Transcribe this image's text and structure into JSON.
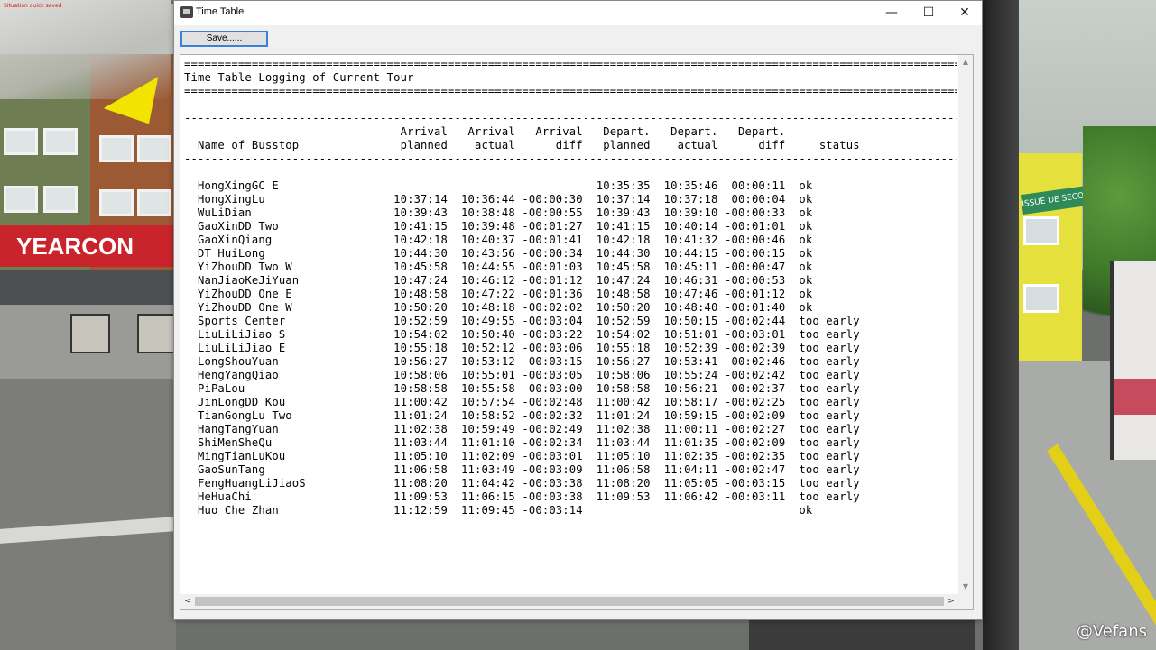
{
  "hud": {
    "quicksave": "Situation quick saved"
  },
  "watermark": "@Vefans",
  "background": {
    "store_sign": "YEARCON",
    "exit_sign": "ISSUE DE SECOURS"
  },
  "window": {
    "title": "Time Table",
    "minimize_glyph": "—",
    "maximize_glyph": "☐",
    "close_glyph": "✕",
    "save_label": "Save......"
  },
  "log": {
    "rule_double": "========================================================================================================================",
    "rule_single": "------------------------------------------------------------------------------------------------------------------------",
    "heading": "Time Table Logging of Current Tour",
    "columns": [
      {
        "top": "",
        "bottom": "Name of Busstop"
      },
      {
        "top": "Arrival",
        "bottom": "planned"
      },
      {
        "top": "Arrival",
        "bottom": "actual"
      },
      {
        "top": "Arrival",
        "bottom": "diff"
      },
      {
        "top": "Depart.",
        "bottom": "planned"
      },
      {
        "top": "Depart.",
        "bottom": "actual"
      },
      {
        "top": "Depart.",
        "bottom": "diff"
      },
      {
        "top": "",
        "bottom": "status"
      }
    ],
    "rows": [
      [
        "HongXingGC E",
        "",
        "",
        "",
        "10:35:35",
        "10:35:46",
        " 00:00:11",
        "ok"
      ],
      [
        "HongXingLu",
        "10:37:14",
        "10:36:44",
        "-00:00:30",
        "10:37:14",
        "10:37:18",
        " 00:00:04",
        "ok"
      ],
      [
        "WuLiDian",
        "10:39:43",
        "10:38:48",
        "-00:00:55",
        "10:39:43",
        "10:39:10",
        "-00:00:33",
        "ok"
      ],
      [
        "GaoXinDD Two",
        "10:41:15",
        "10:39:48",
        "-00:01:27",
        "10:41:15",
        "10:40:14",
        "-00:01:01",
        "ok"
      ],
      [
        "GaoXinQiang",
        "10:42:18",
        "10:40:37",
        "-00:01:41",
        "10:42:18",
        "10:41:32",
        "-00:00:46",
        "ok"
      ],
      [
        "DT HuiLong",
        "10:44:30",
        "10:43:56",
        "-00:00:34",
        "10:44:30",
        "10:44:15",
        "-00:00:15",
        "ok"
      ],
      [
        "YiZhouDD Two W",
        "10:45:58",
        "10:44:55",
        "-00:01:03",
        "10:45:58",
        "10:45:11",
        "-00:00:47",
        "ok"
      ],
      [
        "NanJiaoKeJiYuan",
        "10:47:24",
        "10:46:12",
        "-00:01:12",
        "10:47:24",
        "10:46:31",
        "-00:00:53",
        "ok"
      ],
      [
        "YiZhouDD One E",
        "10:48:58",
        "10:47:22",
        "-00:01:36",
        "10:48:58",
        "10:47:46",
        "-00:01:12",
        "ok"
      ],
      [
        "YiZhouDD One W",
        "10:50:20",
        "10:48:18",
        "-00:02:02",
        "10:50:20",
        "10:48:40",
        "-00:01:40",
        "ok"
      ],
      [
        "Sports Center",
        "10:52:59",
        "10:49:55",
        "-00:03:04",
        "10:52:59",
        "10:50:15",
        "-00:02:44",
        "too early"
      ],
      [
        "LiuLiLiJiao S",
        "10:54:02",
        "10:50:40",
        "-00:03:22",
        "10:54:02",
        "10:51:01",
        "-00:03:01",
        "too early"
      ],
      [
        "LiuLiLiJiao E",
        "10:55:18",
        "10:52:12",
        "-00:03:06",
        "10:55:18",
        "10:52:39",
        "-00:02:39",
        "too early"
      ],
      [
        "LongShouYuan",
        "10:56:27",
        "10:53:12",
        "-00:03:15",
        "10:56:27",
        "10:53:41",
        "-00:02:46",
        "too early"
      ],
      [
        "HengYangQiao",
        "10:58:06",
        "10:55:01",
        "-00:03:05",
        "10:58:06",
        "10:55:24",
        "-00:02:42",
        "too early"
      ],
      [
        "PiPaLou",
        "10:58:58",
        "10:55:58",
        "-00:03:00",
        "10:58:58",
        "10:56:21",
        "-00:02:37",
        "too early"
      ],
      [
        "JinLongDD Kou",
        "11:00:42",
        "10:57:54",
        "-00:02:48",
        "11:00:42",
        "10:58:17",
        "-00:02:25",
        "too early"
      ],
      [
        "TianGongLu Two",
        "11:01:24",
        "10:58:52",
        "-00:02:32",
        "11:01:24",
        "10:59:15",
        "-00:02:09",
        "too early"
      ],
      [
        "HangTangYuan",
        "11:02:38",
        "10:59:49",
        "-00:02:49",
        "11:02:38",
        "11:00:11",
        "-00:02:27",
        "too early"
      ],
      [
        "ShiMenSheQu",
        "11:03:44",
        "11:01:10",
        "-00:02:34",
        "11:03:44",
        "11:01:35",
        "-00:02:09",
        "too early"
      ],
      [
        "MingTianLuKou",
        "11:05:10",
        "11:02:09",
        "-00:03:01",
        "11:05:10",
        "11:02:35",
        "-00:02:35",
        "too early"
      ],
      [
        "GaoSunTang",
        "11:06:58",
        "11:03:49",
        "-00:03:09",
        "11:06:58",
        "11:04:11",
        "-00:02:47",
        "too early"
      ],
      [
        "FengHuangLiJiaoS",
        "11:08:20",
        "11:04:42",
        "-00:03:38",
        "11:08:20",
        "11:05:05",
        "-00:03:15",
        "too early"
      ],
      [
        "HeHuaChi",
        "11:09:53",
        "11:06:15",
        "-00:03:38",
        "11:09:53",
        "11:06:42",
        "-00:03:11",
        "too early"
      ],
      [
        "Huo Che Zhan",
        "11:12:59",
        "11:09:45",
        "-00:03:14",
        "",
        "",
        "",
        "ok"
      ]
    ]
  },
  "scroll": {
    "up": "▲",
    "down": "▼",
    "left": "<",
    "right": ">"
  }
}
